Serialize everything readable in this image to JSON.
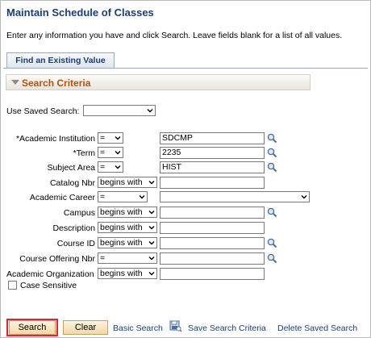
{
  "header": {
    "title": "Maintain Schedule of Classes",
    "instructions": "Enter any information you have and click Search. Leave fields blank for a list of all values."
  },
  "tabs": [
    {
      "label": "Find an Existing Value"
    }
  ],
  "section": {
    "title": "Search Criteria"
  },
  "saved_search": {
    "label": "Use Saved Search:",
    "value": ""
  },
  "fields": {
    "academic_institution": {
      "label": "*Academic Institution",
      "operator": "=",
      "value": "SDCMP"
    },
    "term": {
      "label": "*Term",
      "operator": "=",
      "value": "2235"
    },
    "subject_area": {
      "label": "Subject Area",
      "operator": "=",
      "value": "HIST"
    },
    "catalog_nbr": {
      "label": "Catalog Nbr",
      "operator": "begins with",
      "value": ""
    },
    "academic_career": {
      "label": "Academic Career",
      "operator": "=",
      "value": ""
    },
    "campus": {
      "label": "Campus",
      "operator": "begins with",
      "value": ""
    },
    "description": {
      "label": "Description",
      "operator": "begins with",
      "value": ""
    },
    "course_id": {
      "label": "Course ID",
      "operator": "begins with",
      "value": ""
    },
    "course_offering_nbr": {
      "label": "Course Offering Nbr",
      "operator": "=",
      "value": ""
    },
    "academic_organization": {
      "label": "Academic Organization",
      "operator": "begins with",
      "value": ""
    }
  },
  "case_sensitive": {
    "label": "Case Sensitive",
    "checked": false
  },
  "actions": {
    "search": "Search",
    "clear": "Clear",
    "basic_search": "Basic Search",
    "save_search_criteria": "Save Search Criteria",
    "delete_saved_search": "Delete Saved Search"
  },
  "colors": {
    "title": "#1b3d77",
    "section_title": "#b5530c",
    "highlight": "#e0262c",
    "button_bg": "#f3d9a6"
  },
  "icons": {
    "lookup": "magnifier-lookup-icon",
    "dropdown": "chevron-down-icon",
    "save_search": "save-search-icon"
  }
}
